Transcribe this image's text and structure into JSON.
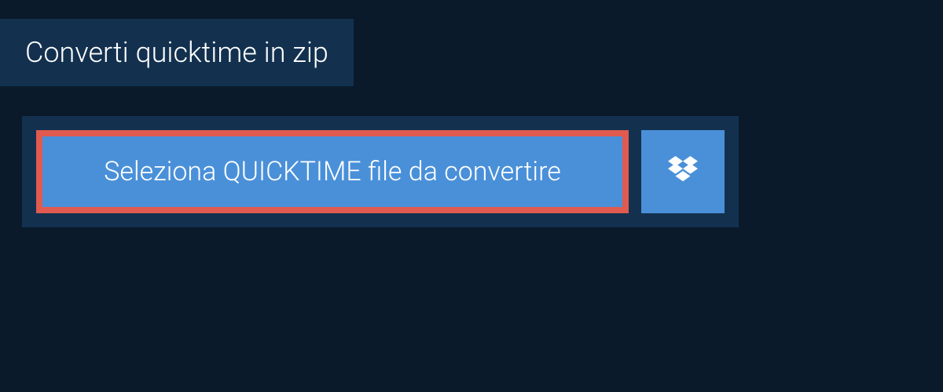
{
  "header": {
    "title": "Converti quicktime in zip"
  },
  "actions": {
    "select_file_label": "Seleziona QUICKTIME file da convertire"
  },
  "colors": {
    "background": "#0a1a2a",
    "panel": "#13314f",
    "button": "#4a90d9",
    "highlight_border": "#e05a4f"
  }
}
